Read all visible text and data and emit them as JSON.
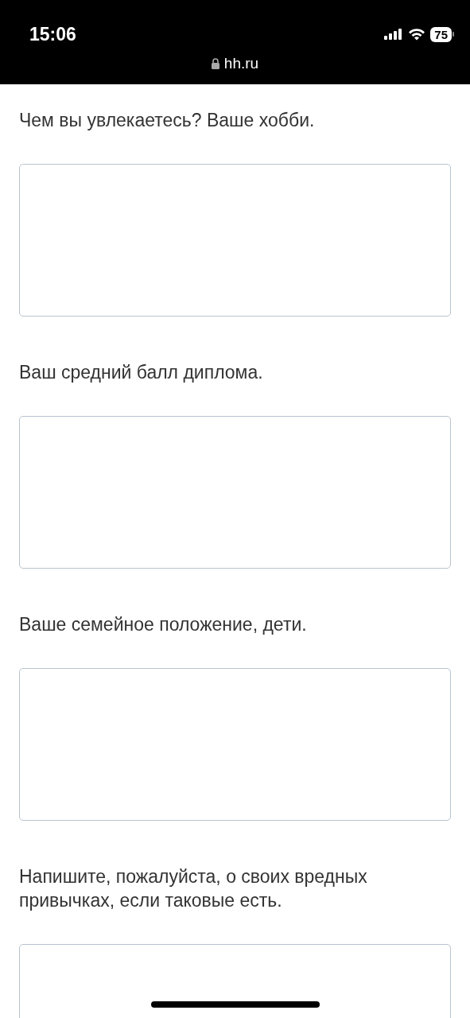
{
  "status_bar": {
    "time": "15:06",
    "battery": "75"
  },
  "address_bar": {
    "url": "hh.ru",
    "secure": true
  },
  "questions": [
    {
      "label": "Чем вы увлекаетесь? Ваше хобби."
    },
    {
      "label": "Ваш средний балл диплома."
    },
    {
      "label": "Ваше семейное положение, дети."
    },
    {
      "label": "Напишите, пожалуйста, о своих вредных привычках, если таковые есть."
    }
  ]
}
